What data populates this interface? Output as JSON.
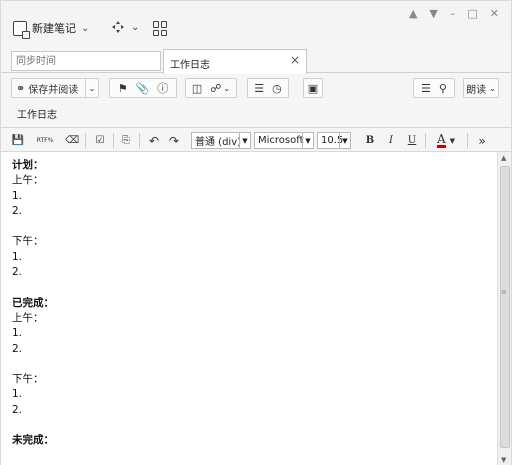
{
  "titlebar": {
    "new_note_label": "新建笔记",
    "window_controls": [
      "shirt-icon",
      "pin-icon",
      "minimize-icon",
      "maximize-icon",
      "close-icon"
    ]
  },
  "tabs": {
    "sync_placeholder": "同步时间",
    "active_tab": "工作日志",
    "close_glyph": "×"
  },
  "toolbar": {
    "save_read_label": "保存并阅读",
    "read_aloud_label": "朗读"
  },
  "note": {
    "title": "工作日志"
  },
  "format": {
    "paragraph_style": "普通 (div)",
    "font_name": "Microsoft",
    "font_size": "10.5",
    "bold": "B",
    "italic": "I",
    "underline": "U",
    "font_color_letter": "A",
    "font_color": "#cc0000",
    "more": "»"
  },
  "editor": {
    "lines": [
      {
        "text": "计划：",
        "bold": true
      },
      {
        "text": "上午：",
        "bold": false
      },
      {
        "text": "1.",
        "bold": false
      },
      {
        "text": "2.",
        "bold": false
      },
      {
        "text": "",
        "bold": false
      },
      {
        "text": "下午：",
        "bold": false
      },
      {
        "text": "1.",
        "bold": false
      },
      {
        "text": "2.",
        "bold": false
      },
      {
        "text": "",
        "bold": false
      },
      {
        "text": "已完成：",
        "bold": true
      },
      {
        "text": "上午：",
        "bold": false
      },
      {
        "text": "1.",
        "bold": false
      },
      {
        "text": "2.",
        "bold": false
      },
      {
        "text": "",
        "bold": false
      },
      {
        "text": "下午：",
        "bold": false
      },
      {
        "text": "1.",
        "bold": false
      },
      {
        "text": "2.",
        "bold": false
      },
      {
        "text": "",
        "bold": false
      },
      {
        "text": "未完成：",
        "bold": true
      }
    ]
  }
}
